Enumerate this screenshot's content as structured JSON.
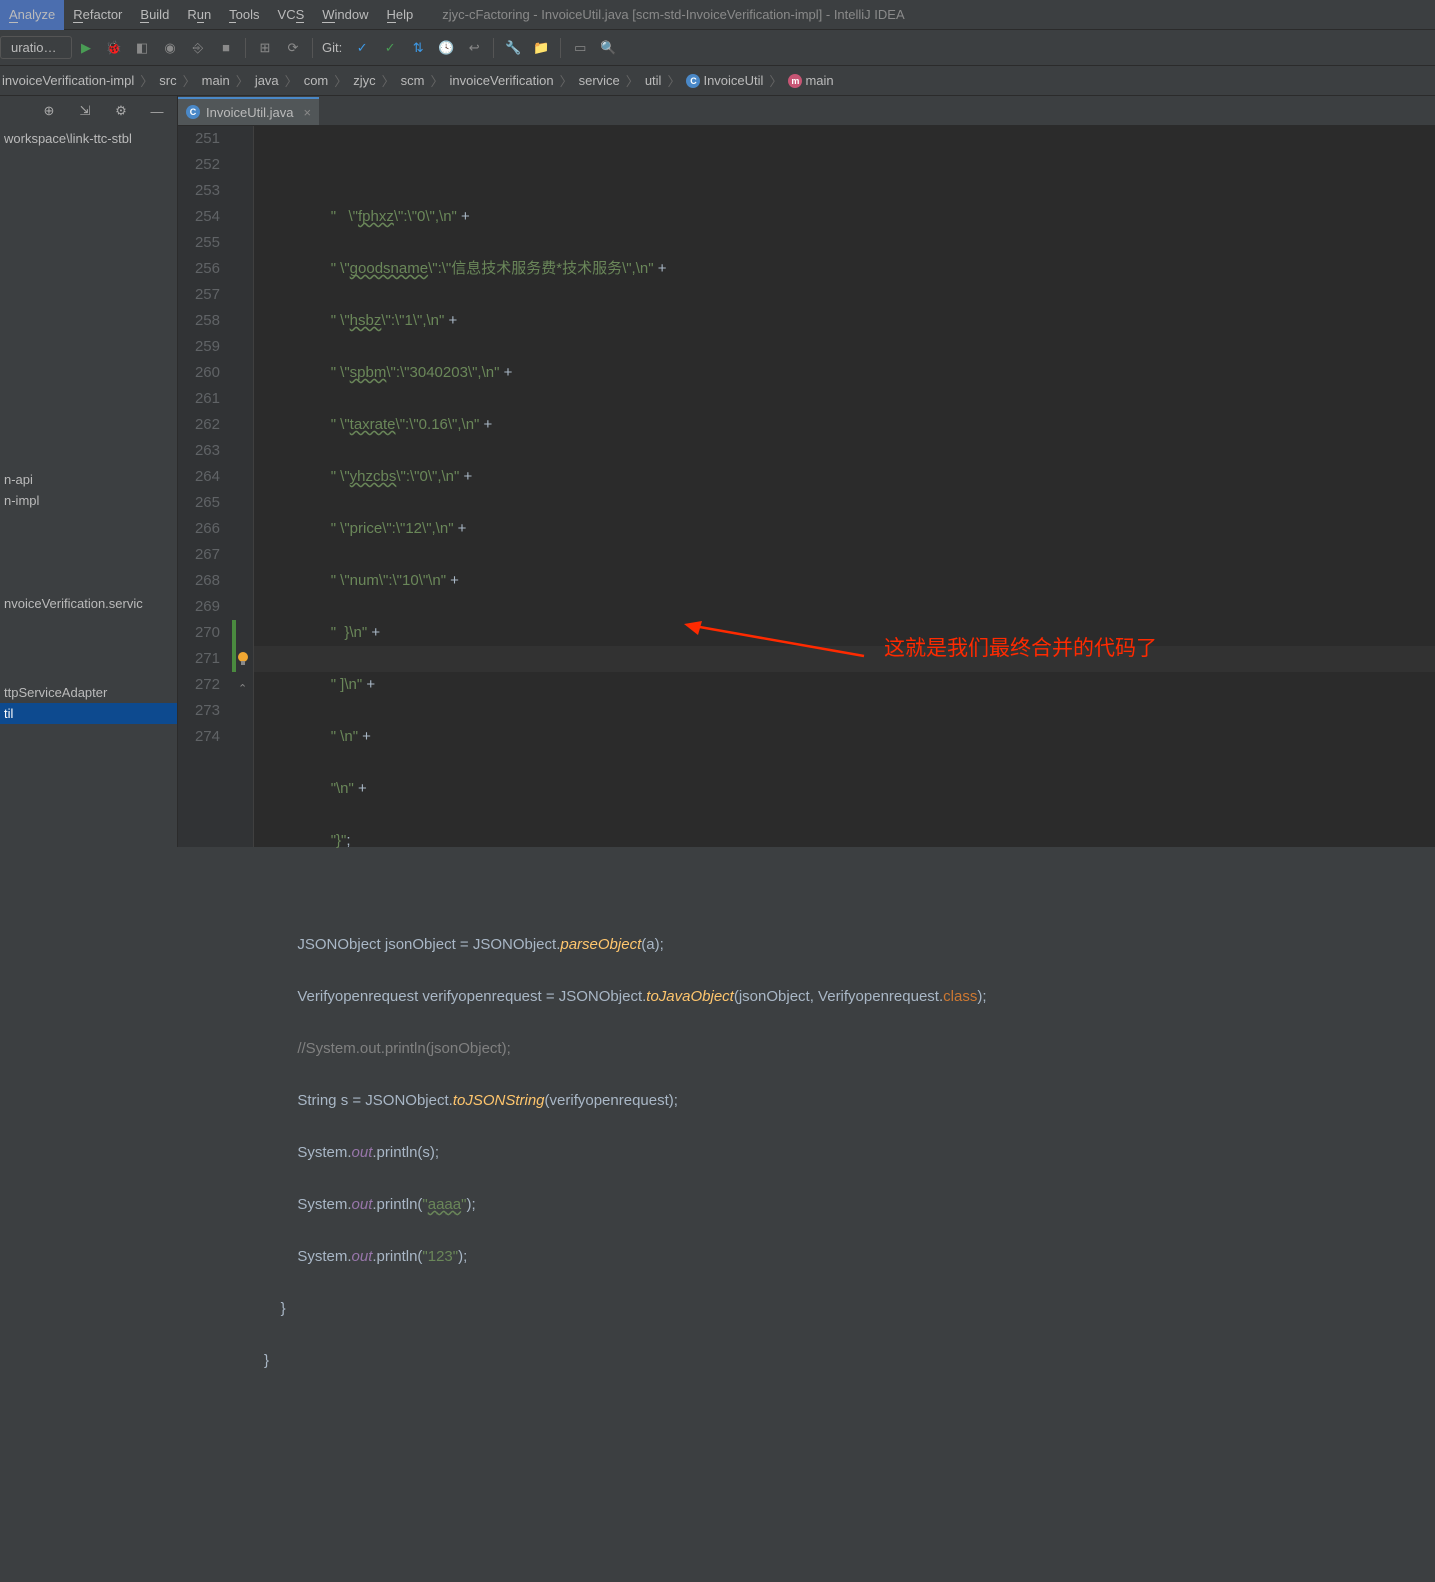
{
  "window_title": "zjyc-cFactoring - InvoiceUtil.java [scm-std-InvoiceVerification-impl] - IntelliJ IDEA",
  "menus": {
    "analyze": "Analyze",
    "refactor": "Refactor",
    "build": "Build",
    "run": "Run",
    "tools": "Tools",
    "vcs": "VCS",
    "window": "Window",
    "help": "Help"
  },
  "run_config": "uration...",
  "git_label": "Git:",
  "breadcrumbs": {
    "b0": "invoiceVerification-impl",
    "b1": "src",
    "b2": "main",
    "b3": "java",
    "b4": "com",
    "b5": "zjyc",
    "b6": "scm",
    "b7": "invoiceVerification",
    "b8": "service",
    "b9": "util",
    "b10": "InvoiceUtil",
    "b11": "main"
  },
  "tab": {
    "label": "InvoiceUtil.java"
  },
  "tree": {
    "t0": "workspace\\link-ttc-stbl",
    "t1": "n-api",
    "t2": "n-impl",
    "t3": "nvoiceVerification.servic",
    "t4": "ttpServiceAdapter",
    "t5": "til"
  },
  "gutter": {
    "start": 251,
    "end": 274
  },
  "code": {
    "l251_a": "\"   \\\"",
    "l251_typo": "fphxz",
    "l251_b": "\\\":\\\"0\\\",\\n\"",
    "l251_c": " +",
    "l252_a": "\" \\\"",
    "l252_typo": "goodsname",
    "l252_b": "\\\":\\\"信息技术服务费*技术服务\\\",\\n\"",
    "l252_c": " +",
    "l253_a": "\" \\\"",
    "l253_typo": "hsbz",
    "l253_b": "\\\":\\\"1\\\",\\n\"",
    "l253_c": " +",
    "l254_a": "\" \\\"",
    "l254_typo": "spbm",
    "l254_b": "\\\":\\\"3040203\\\",\\n\"",
    "l254_c": " +",
    "l255_a": "\" \\\"",
    "l255_typo": "taxrate",
    "l255_b": "\\\":\\\"0.16\\\",\\n\"",
    "l255_c": " +",
    "l256_a": "\" \\\"",
    "l256_typo": "yhzcbs",
    "l256_b": "\\\":\\\"0\\\",\\n\"",
    "l256_c": " +",
    "l257_a": "\" \\\"price\\\":\\\"12\\\",\\n\"",
    "l257_c": " +",
    "l258_a": "\" \\\"num\\\":\\\"10\\\"\\n\"",
    "l258_c": " +",
    "l259_a": "\"  }\\n\"",
    "l259_c": " +",
    "l260_a": "\" ]\\n\"",
    "l260_c": " +",
    "l261_a": "\" \\n\"",
    "l261_c": " +",
    "l262_a": "\"\\n\"",
    "l262_c": " +",
    "l263_a": "\"}\"",
    "l263_c": ";",
    "l265_a": "JSONObject jsonObject = JSONObject.",
    "l265_m": "parseObject",
    "l265_b": "(a);",
    "l266_a": "Verifyopenrequest verifyopenrequest = JSONObject.",
    "l266_m": "toJavaObject",
    "l266_b": "(jsonObject, Verifyopenrequest.",
    "l266_kw": "class",
    "l266_c": ");",
    "l267": "//System.out.println(jsonObject);",
    "l268_a": "String s = JSONObject.",
    "l268_m": "toJSONString",
    "l268_b": "(verifyopenrequest);",
    "l269_a": "System.",
    "l269_f": "out",
    "l269_b": ".println(s);",
    "l270_a": "System.",
    "l270_f": "out",
    "l270_b": ".println(",
    "l270_s": "\"",
    "l270_typo": "aaaa",
    "l270_s2": "\"",
    "l270_c": ");",
    "l271_a": "System.",
    "l271_f": "out",
    "l271_b": ".println(",
    "l271_s": "\"123\"",
    "l271_c": ");",
    "l272": "    }",
    "l273": "}"
  },
  "annotation": "这就是我们最终合并的代码了"
}
